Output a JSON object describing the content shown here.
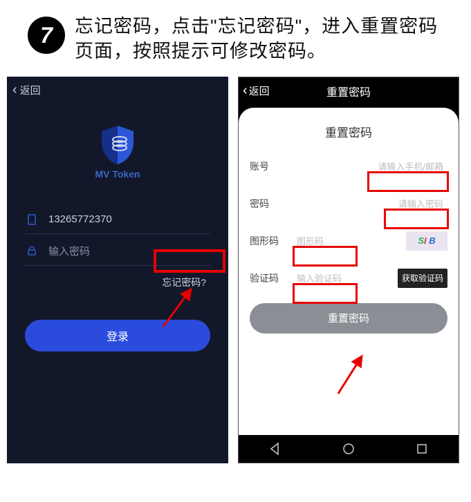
{
  "step": {
    "number": "7",
    "text": "忘记密码，点击\"忘记密码\"，进入重置密码页面，按照提示可修改密码。"
  },
  "left_phone": {
    "back_label": "返回",
    "app_name": "MV Token",
    "username_value": "13265772370",
    "password_placeholder": "输入密码",
    "forgot_label": "忘记密码?",
    "login_label": "登录"
  },
  "right_phone": {
    "back_label": "返回",
    "title": "重置密码",
    "card_title": "重置密码",
    "rows": {
      "account": {
        "label": "账号",
        "placeholder": "请输入手机/邮箱"
      },
      "password": {
        "label": "密码",
        "placeholder": "请输入密码"
      },
      "captcha": {
        "label": "图形码",
        "placeholder": "图形码",
        "captcha_text": "SI B"
      },
      "sms": {
        "label": "验证码",
        "placeholder": "输入验证码",
        "button": "获取验证码"
      }
    },
    "submit_label": "重置密码"
  }
}
